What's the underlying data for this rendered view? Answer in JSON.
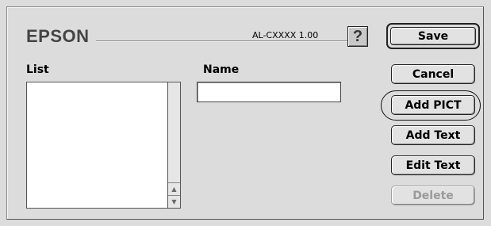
{
  "header": {
    "brand": "EPSON",
    "model": "AL-CXXXX 1.00",
    "help_label": "?"
  },
  "list": {
    "label": "List",
    "items": []
  },
  "name": {
    "label": "Name",
    "value": ""
  },
  "buttons": {
    "save": "Save",
    "cancel": "Cancel",
    "add_pict": "Add PICT",
    "add_text": "Add Text",
    "edit_text": "Edit Text",
    "delete": "Delete"
  },
  "scrollbar": {
    "up_glyph": "▲",
    "down_glyph": "▼"
  }
}
